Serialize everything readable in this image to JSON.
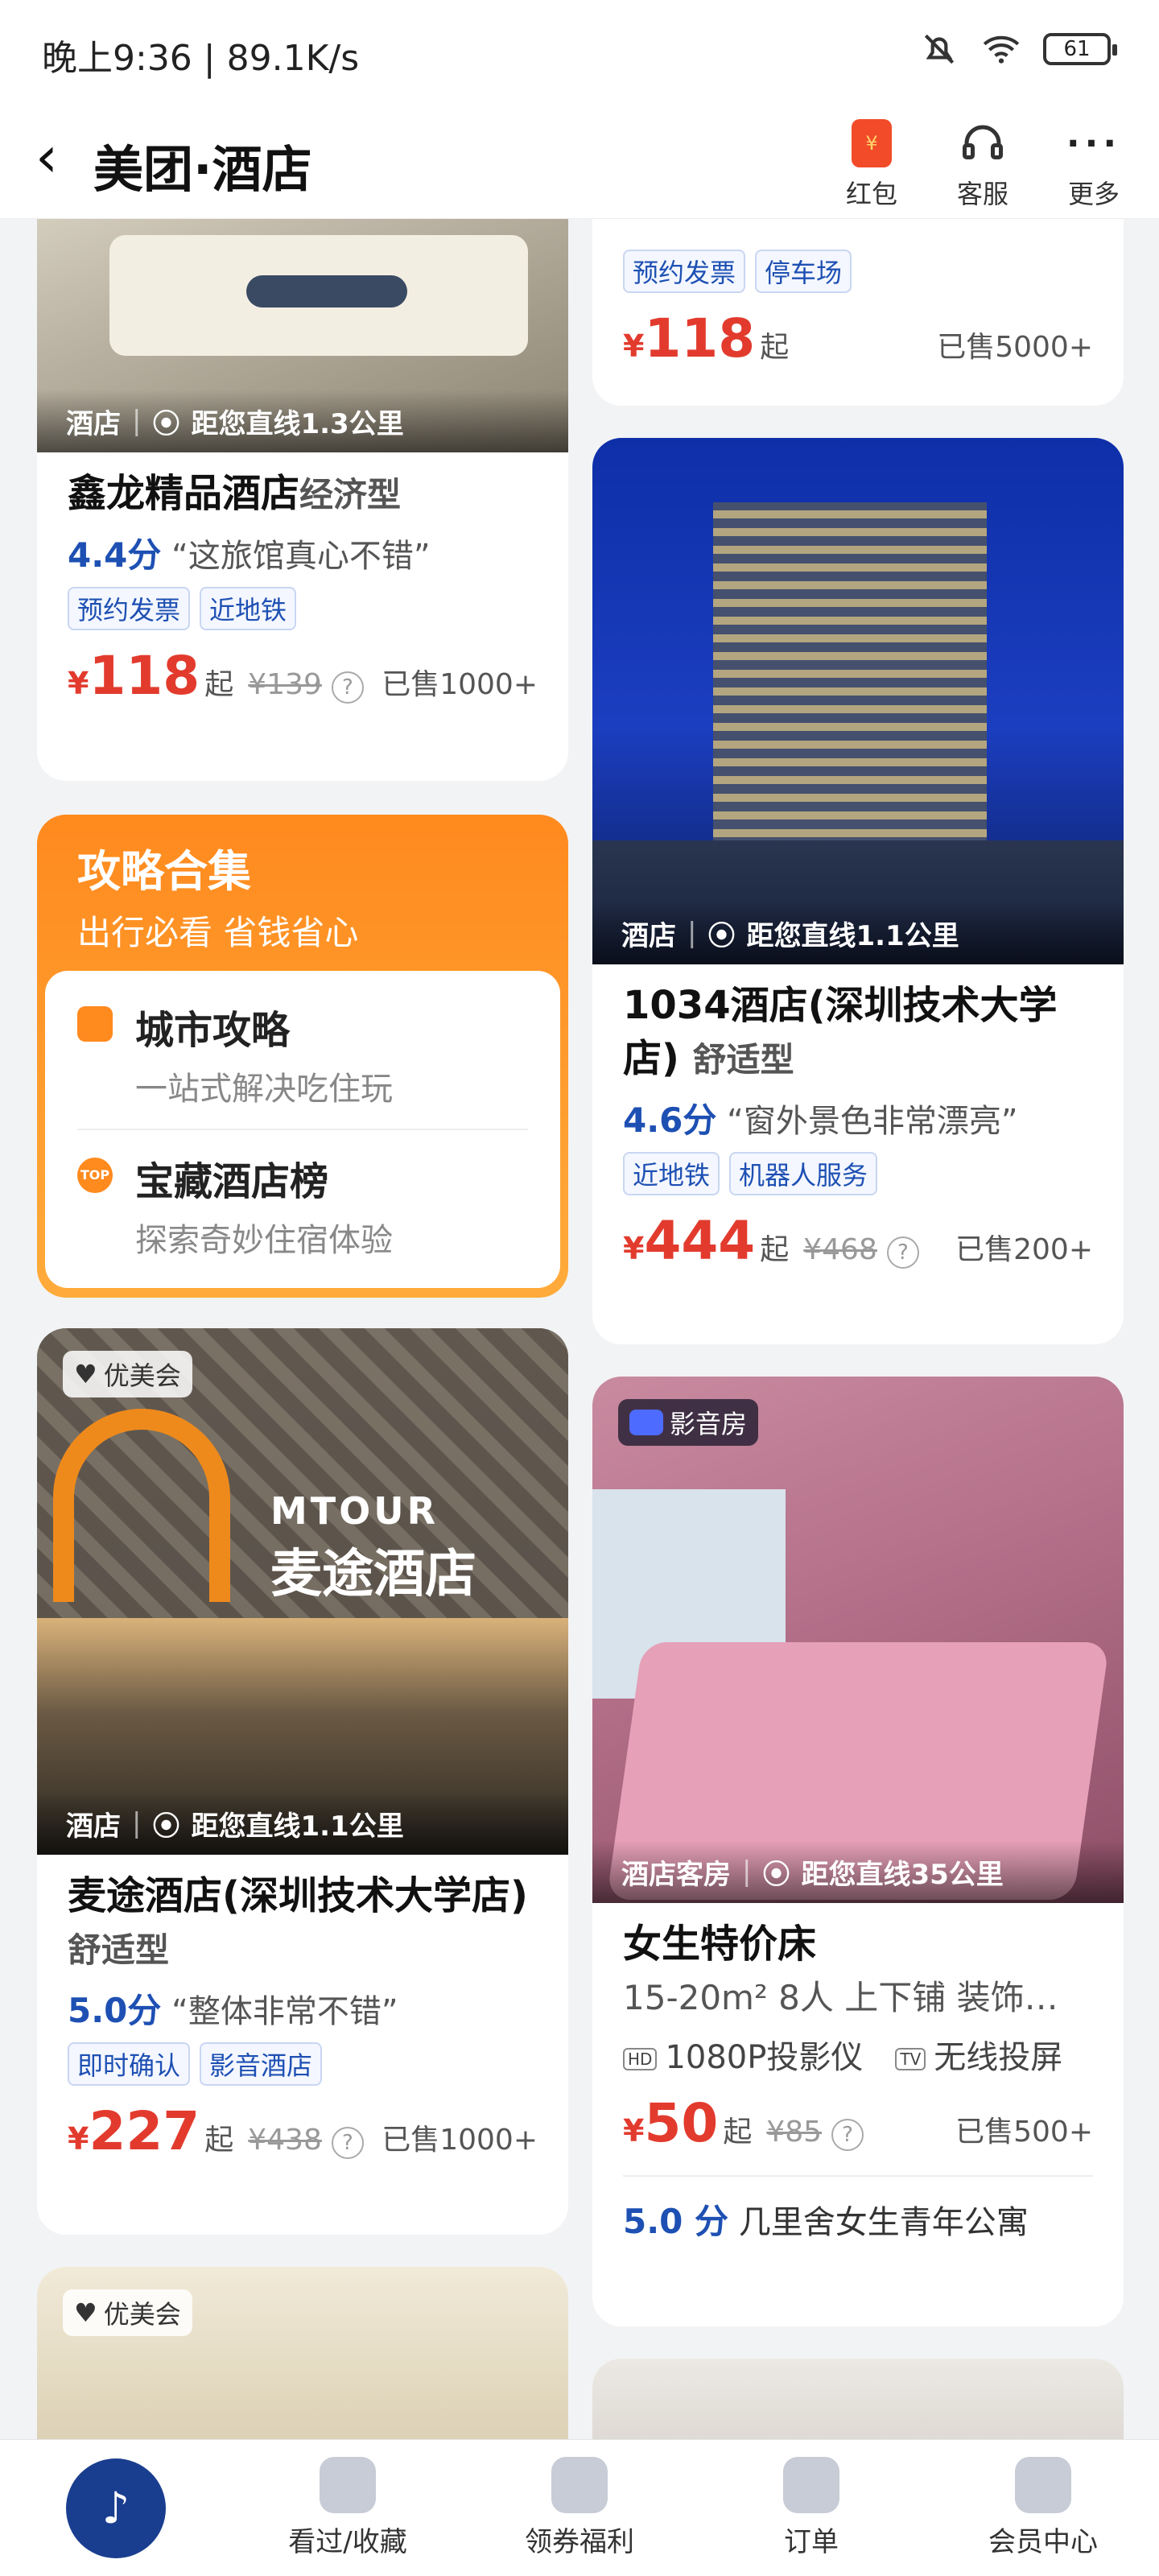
{
  "status": {
    "time": "晚上9:36 | 89.1K/s",
    "battery": "61"
  },
  "nav": {
    "title": "美团·酒店",
    "actions": [
      {
        "label": "红包",
        "icon": "red-packet-icon"
      },
      {
        "label": "客服",
        "icon": "headset-icon"
      },
      {
        "label": "更多",
        "icon": "more-dots-icon"
      }
    ]
  },
  "left": {
    "card1": {
      "category": "酒店",
      "distance": "距您直线1.3公里",
      "name": "鑫龙精品酒店",
      "type": "经济型",
      "score": "4.4分",
      "review": "“这旅馆真心不错”",
      "tags": [
        "预约发票",
        "近地铁"
      ],
      "price": "118",
      "price_unit": "起",
      "orig": "¥139",
      "sold": "已售1000+"
    },
    "guide": {
      "title": "攻略合集",
      "subtitle": "出行必看 省钱省心",
      "items": [
        {
          "title": "城市攻略",
          "desc": "一站式解决吃住玩"
        },
        {
          "title": "宝藏酒店榜",
          "desc": "探索奇妙住宿体验"
        }
      ]
    },
    "card2": {
      "badge": "优美会",
      "sign_en": "MTOUR",
      "sign_cn": "麦途酒店",
      "category": "酒店",
      "distance": "距您直线1.1公里",
      "name": "麦途酒店(深圳技术大学店)",
      "type": "舒适型",
      "score": "5.0分",
      "review": "“整体非常不错”",
      "tags": [
        "即时确认",
        "影音酒店"
      ],
      "price": "227",
      "price_unit": "起",
      "orig": "¥438",
      "sold": "已售1000+"
    },
    "card3": {
      "badge": "优美会"
    }
  },
  "right": {
    "card1": {
      "tags": [
        "预约发票",
        "停车场"
      ],
      "price": "118",
      "price_unit": "起",
      "sold": "已售5000+"
    },
    "card2": {
      "category": "酒店",
      "distance": "距您直线1.1公里",
      "name": "1034酒店(深圳技术大学店)",
      "type": "舒适型",
      "score": "4.6分",
      "review": "“窗外景色非常漂亮”",
      "tags": [
        "近地铁",
        "机器人服务"
      ],
      "price": "444",
      "price_unit": "起",
      "orig": "¥468",
      "sold": "已售200+"
    },
    "card3": {
      "badge": "影音房",
      "category": "酒店客房",
      "distance": "距您直线35公里",
      "name": "女生特价床",
      "desc": "15-20m² 8人 上下铺 装饰…",
      "features": [
        {
          "icon": "HD",
          "label": "1080P投影仪"
        },
        {
          "icon": "TV",
          "label": "无线投屏"
        }
      ],
      "price": "50",
      "price_unit": "起",
      "orig": "¥85",
      "sold": "已售500+",
      "score": "5.0 分",
      "host": "几里舍女生青年公寓"
    }
  },
  "tabbar": [
    {
      "label": "",
      "icon": "home-icon"
    },
    {
      "label": "看过/收藏",
      "icon": "star-icon"
    },
    {
      "label": "领券福利",
      "icon": "coupon-icon"
    },
    {
      "label": "订单",
      "icon": "order-icon"
    },
    {
      "label": "会员中心",
      "icon": "member-icon"
    }
  ],
  "colors": {
    "price": "#e23b2e",
    "score": "#1e50b3",
    "guide": "#ff8a1e",
    "tab_active": "#1a3e8f"
  }
}
